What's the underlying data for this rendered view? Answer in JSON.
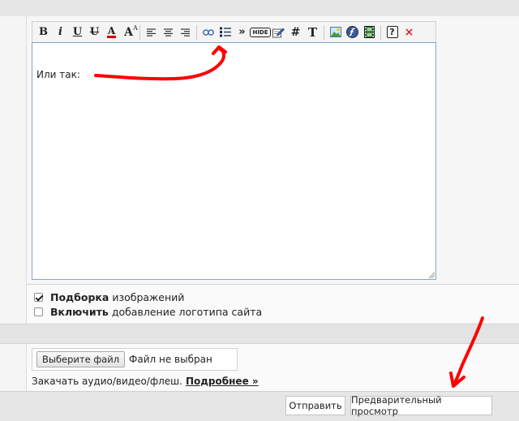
{
  "toolbar": {
    "buttons": {
      "bold": "B",
      "italic": "i",
      "underline": "U",
      "strike": "U",
      "font_color": "A",
      "font_size": "A",
      "more": "»",
      "hide": "HIDE",
      "hash": "#",
      "text": "T",
      "help": "?",
      "close": "×"
    }
  },
  "editor": {
    "content": "Или так:"
  },
  "options": {
    "gallery": {
      "checked": true,
      "strong": "Подборка",
      "rest": "изображений"
    },
    "logo": {
      "checked": false,
      "strong": "Включить",
      "rest": "добавление логотипа сайта"
    }
  },
  "upload": {
    "choose_button": "Выберите файл",
    "status": "Файл не выбран",
    "hint": "Закачать аудио/видео/флеш.",
    "more_link": "Подробнее »"
  },
  "actions": {
    "submit": "Отправить",
    "preview": "Предварительный просмотр"
  },
  "colors": {
    "annotation_red": "#ff0000",
    "editor_border": "#7fa6cf",
    "link_icon_blue": "#3d6fb5"
  }
}
